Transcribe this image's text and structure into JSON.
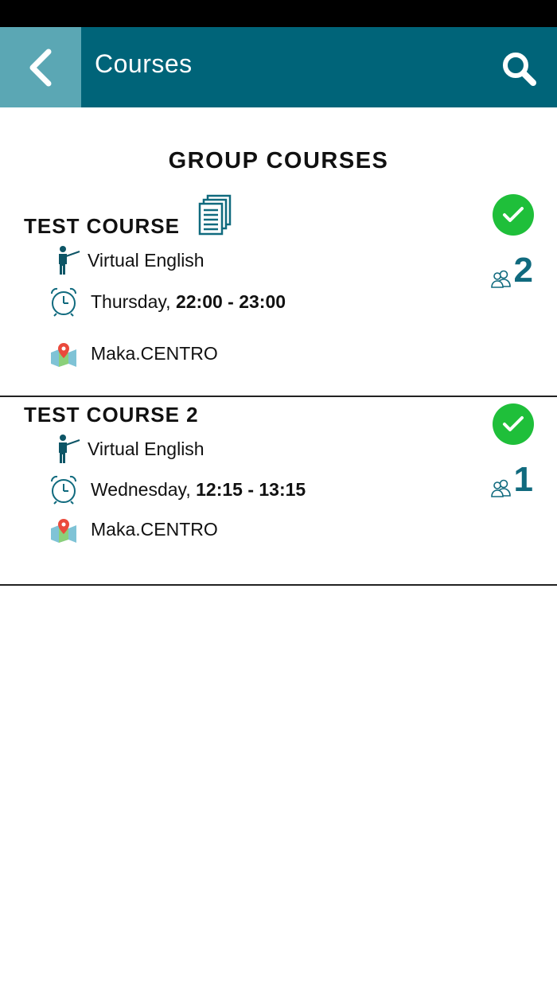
{
  "header": {
    "title": "Courses"
  },
  "section": {
    "heading": "GROUP COURSES"
  },
  "courses": [
    {
      "title": "TEST COURSE",
      "teacher": "Virtual English",
      "day": "Thursday,",
      "time": "22:00 - 23:00",
      "location": "Maka.CENTRO",
      "participants": "2"
    },
    {
      "title": "TEST COURSE 2",
      "teacher": "Virtual English",
      "day": "Wednesday,",
      "time": "12:15 - 13:15",
      "location": "Maka.CENTRO",
      "participants": "1"
    }
  ],
  "colors": {
    "app_bar": "#006479",
    "back_button": "#5ba7b4",
    "accent": "#106a7e",
    "check": "#1fbf3a"
  },
  "icons": {
    "back": "chevron-left-icon",
    "search": "search-icon",
    "documents": "documents-icon",
    "teacher": "teacher-icon",
    "clock": "alarm-clock-icon",
    "location": "map-pin-icon",
    "check": "check-icon",
    "participants": "people-icon"
  }
}
